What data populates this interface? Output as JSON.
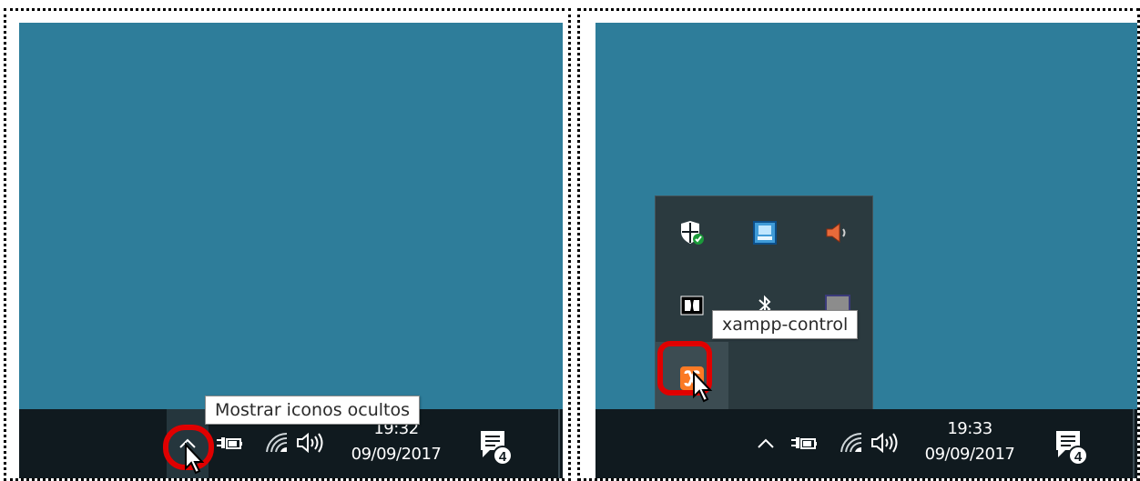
{
  "left_panel": {
    "tooltip": "Mostrar iconos ocultos",
    "clock": {
      "time": "19:32",
      "date": "09/09/2017"
    },
    "notification_count": "4"
  },
  "right_panel": {
    "tooltip": "xampp-control",
    "clock": {
      "time": "19:33",
      "date": "09/09/2017"
    },
    "notification_count": "4",
    "tray_icons": [
      "windows-defender-icon",
      "network-adapter-icon",
      "speaker-muted-icon",
      "dolby-icon",
      "bluetooth-icon",
      "display-icon",
      "xampp-control-icon"
    ]
  },
  "colors": {
    "desktop": "#2e7d9a",
    "taskbar": "#101a1f",
    "highlight": "#e00000"
  }
}
